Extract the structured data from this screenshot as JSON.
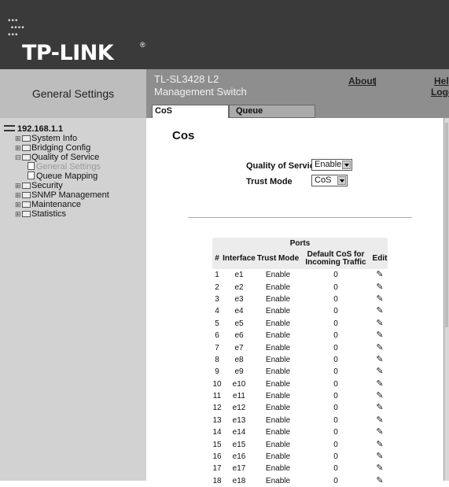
{
  "brand": {
    "logo_text": "TP-LINK",
    "reg_mark": "®"
  },
  "header": {
    "section_title": "General Settings",
    "model_line1": "TL-SL3428 L2",
    "model_line2": "Management Switch",
    "about": "About",
    "about_sep": "|",
    "help": "Help",
    "logout": "Logout"
  },
  "tabs": [
    {
      "label": "CoS",
      "active": true
    },
    {
      "label": "Queue",
      "active": false
    }
  ],
  "tree": {
    "root": "192.168.1.1",
    "items": [
      {
        "label": "System Info"
      },
      {
        "label": "Bridging Config"
      },
      {
        "label": "Quality of Service"
      },
      {
        "label": "General Settings"
      },
      {
        "label": "Queue Mapping"
      },
      {
        "label": "Security"
      },
      {
        "label": "SNMP Management"
      },
      {
        "label": "Maintenance"
      },
      {
        "label": "Statistics"
      }
    ]
  },
  "page": {
    "title": "Cos",
    "qos_label": "Quality of Service",
    "qos_value": "Enable",
    "trust_label": "Trust Mode",
    "trust_value": "CoS"
  },
  "ports": {
    "caption": "Ports",
    "columns": [
      "#",
      "Interface",
      "Trust Mode",
      "Default CoS for Incoming Traffic",
      "Edit"
    ],
    "rows": [
      [
        "1",
        "e1",
        "Enable",
        "0"
      ],
      [
        "2",
        "e2",
        "Enable",
        "0"
      ],
      [
        "3",
        "e3",
        "Enable",
        "0"
      ],
      [
        "4",
        "e4",
        "Enable",
        "0"
      ],
      [
        "5",
        "e5",
        "Enable",
        "0"
      ],
      [
        "6",
        "e6",
        "Enable",
        "0"
      ],
      [
        "7",
        "e7",
        "Enable",
        "0"
      ],
      [
        "8",
        "e8",
        "Enable",
        "0"
      ],
      [
        "9",
        "e9",
        "Enable",
        "0"
      ],
      [
        "10",
        "e10",
        "Enable",
        "0"
      ],
      [
        "11",
        "e11",
        "Enable",
        "0"
      ],
      [
        "12",
        "e12",
        "Enable",
        "0"
      ],
      [
        "13",
        "e13",
        "Enable",
        "0"
      ],
      [
        "14",
        "e14",
        "Enable",
        "0"
      ],
      [
        "15",
        "e15",
        "Enable",
        "0"
      ],
      [
        "16",
        "e16",
        "Enable",
        "0"
      ],
      [
        "17",
        "e17",
        "Enable",
        "0"
      ],
      [
        "18",
        "e18",
        "Enable",
        "0"
      ]
    ],
    "edit_icon": "pencil-icon"
  }
}
